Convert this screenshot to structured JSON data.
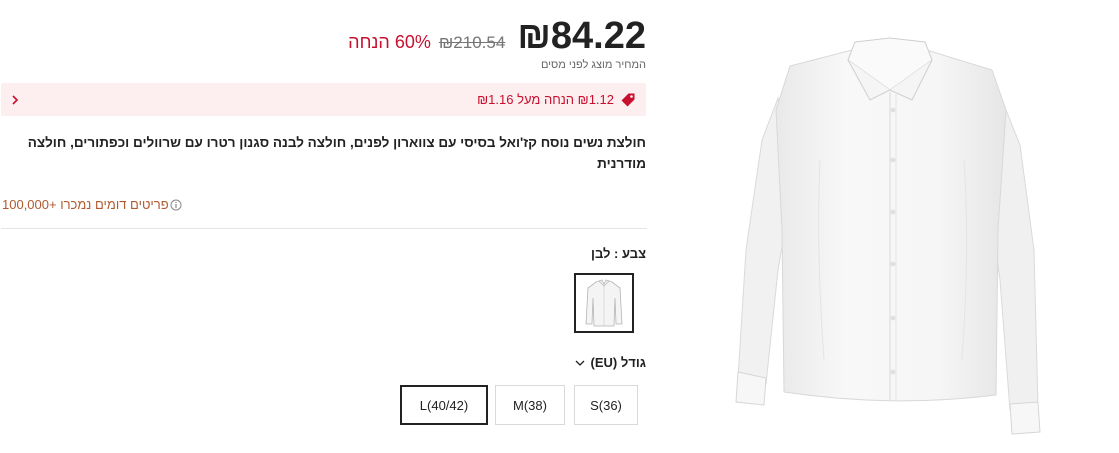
{
  "price": {
    "current": "₪84.22",
    "original": "₪210.54",
    "discount": "60% הנחה",
    "tax_note": "המחיר מוצג לפני מסים"
  },
  "promo": {
    "text": "₪1.12 הנחה מעל ₪1.16",
    "icon": "tag-icon",
    "chevron": "chevron-left-icon"
  },
  "product": {
    "title": "חולצת נשים נוסח קז'ואל בסיסי עם צווארון לפנים, חולצה לבנה סגנון רטרו עם שרוולים וכפתורים, חולצה מודרנית"
  },
  "sold": {
    "text": "פריטים דומים נמכרו +100,000",
    "icon": "info-icon"
  },
  "color": {
    "label": "צבע : לבן",
    "selected_swatch": "white-shirt-thumbnail"
  },
  "size": {
    "label": "גודל (EU)",
    "options": [
      "S(36)",
      "M(38)",
      "L(40/42)"
    ],
    "selected": "L(40/42)"
  },
  "colors": {
    "accent_red": "#c8102e",
    "promo_bg": "#fdeef0",
    "sold_text": "#b05a2f",
    "text": "#222222"
  }
}
